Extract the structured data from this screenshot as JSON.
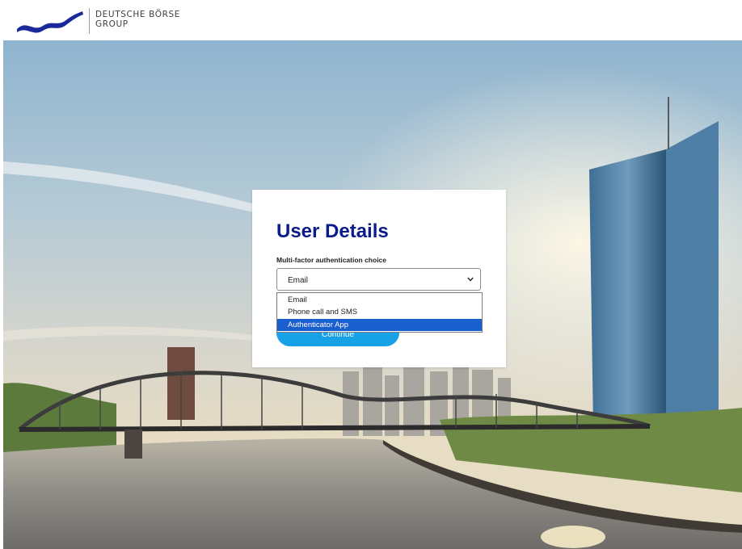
{
  "brand": {
    "line1": "DEUTSCHE BÖRSE",
    "line2": "GROUP"
  },
  "card": {
    "title": "User Details",
    "mfa_label": "Multi-factor authentication choice",
    "selected_value": "Email",
    "continue_label": "Continue"
  },
  "dropdown": {
    "options": [
      "Email",
      "Phone call and SMS",
      "Authenticator App"
    ],
    "highlighted": "Authenticator App"
  },
  "colors": {
    "title": "#0a1b8a",
    "button": "#17a2e8",
    "highlight": "#1a5fd0",
    "logo": "#1b2a9a"
  },
  "icons": {
    "select_arrow": "chevron-down-icon",
    "logo": "deutsche-boerse-logo-icon"
  }
}
